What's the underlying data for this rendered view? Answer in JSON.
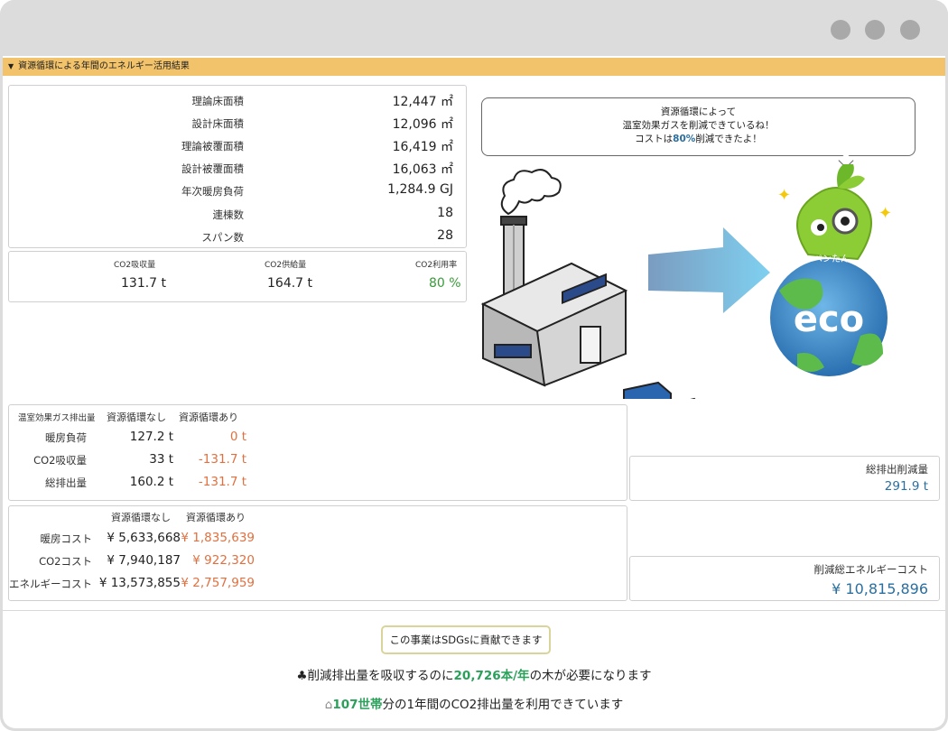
{
  "section": {
    "title": "資源循環による年間のエネルギー活用結果"
  },
  "area": {
    "rows": [
      {
        "label": "理論床面積",
        "value": "12,447 ㎡"
      },
      {
        "label": "設計床面積",
        "value": "12,096 ㎡"
      },
      {
        "label": "理論被覆面積",
        "value": "16,419 ㎡"
      },
      {
        "label": "設計被覆面積",
        "value": "16,063 ㎡"
      },
      {
        "label": "年次暖房負荷",
        "value": "1,284.9 GJ"
      },
      {
        "label": "連棟数",
        "value": "18"
      },
      {
        "label": "スパン数",
        "value": "28"
      }
    ]
  },
  "co2": {
    "absorb_label": "CO2吸収量",
    "absorb_value": "131.7 t",
    "supply_label": "CO2供給量",
    "supply_value": "164.7 t",
    "util_label": "CO2利用率",
    "util_value": "80 %"
  },
  "ghg": {
    "header_label": "温室効果ガス排出量",
    "col_without": "資源循環なし",
    "col_with": "資源循環あり",
    "rows": [
      {
        "label": "暖房負荷",
        "without": "127.2 t",
        "with": "0 t"
      },
      {
        "label": "CO2吸収量",
        "without": "33 t",
        "with": "-131.7 t"
      },
      {
        "label": "総排出量",
        "without": "160.2 t",
        "with": "-131.7 t"
      }
    ]
  },
  "cost": {
    "col_without": "資源循環なし",
    "col_with": "資源循環あり",
    "rows": [
      {
        "label": "暖房コスト",
        "without": "¥ 5,633,668",
        "with": "¥ 1,835,639"
      },
      {
        "label": "CO2コスト",
        "without": "¥ 7,940,187",
        "with": "¥ 922,320"
      },
      {
        "label": "エネルギーコスト",
        "without": "¥ 13,573,855",
        "with": "¥ 2,757,959"
      }
    ]
  },
  "totals": {
    "emission_label": "総排出削減量",
    "emission_value": "291.9 t",
    "cost_label": "削減総エネルギーコスト",
    "cost_value": "¥ 10,815,896"
  },
  "bubble": {
    "line1": "資源循環によって",
    "line2": "温室効果ガスを削減できているね！",
    "line3_pre": "コストは",
    "line3_pct": "80%",
    "line3_post": "削減できたよ！"
  },
  "mascot": {
    "name": "ペンたん",
    "eco_label": "eco"
  },
  "footer": {
    "sdgs_badge": "この事業はSDGsに貢献できます",
    "tree_pre": "削減排出量を吸収するのに",
    "tree_value": "20,726本/年",
    "tree_post": "の木が必要になります",
    "house_value": "107世帯",
    "house_post": "分の1年間のCO2排出量を利用できています"
  },
  "icons": [
    "tree-icon",
    "house-icon",
    "chevron-down-icon"
  ],
  "colors": {
    "accent_bar": "#f2c36b",
    "highlight_green": "#2aa05a",
    "value_blue": "#2a6fa0",
    "value_orange": "#e07040"
  }
}
